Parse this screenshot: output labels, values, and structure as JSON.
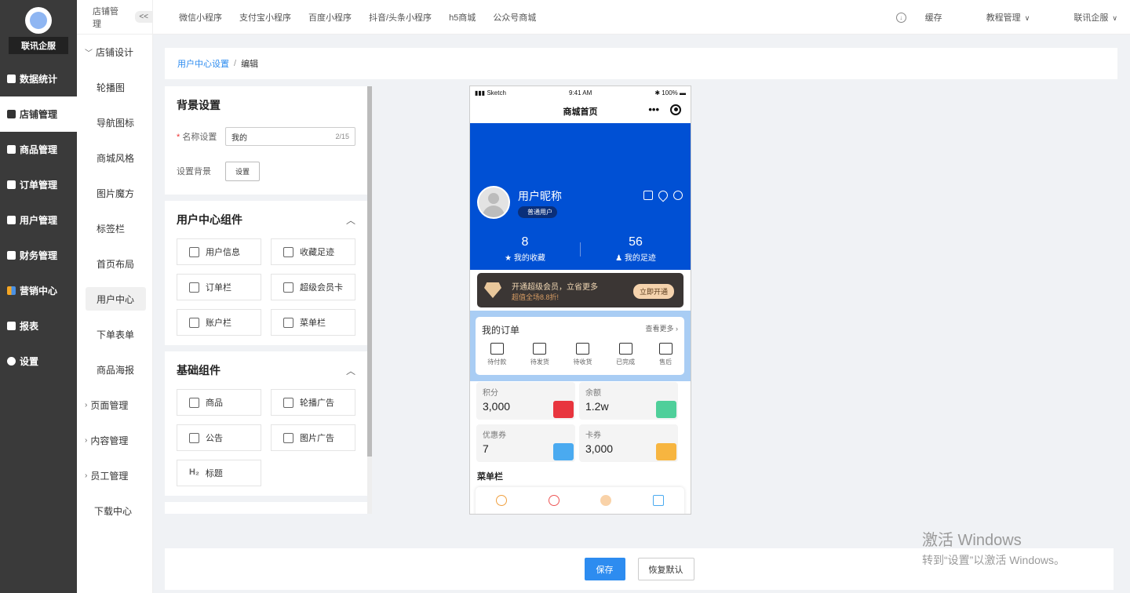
{
  "sidebar": {
    "brand": "联讯企服",
    "items": [
      {
        "label": "数据统计",
        "icon": "chart-icon"
      },
      {
        "label": "店铺管理",
        "icon": "shop-icon",
        "active": true
      },
      {
        "label": "商品管理",
        "icon": "goods-icon"
      },
      {
        "label": "订单管理",
        "icon": "order-icon"
      },
      {
        "label": "用户管理",
        "icon": "user-icon"
      },
      {
        "label": "财务管理",
        "icon": "finance-icon"
      },
      {
        "label": "营销中心",
        "icon": "marketing-icon"
      },
      {
        "label": "报表",
        "icon": "report-icon"
      },
      {
        "label": "设置",
        "icon": "settings-icon"
      }
    ]
  },
  "subsidebar": {
    "title": "店铺管理",
    "collapse": "<<",
    "group_open": "店铺设计",
    "items": [
      "轮播图",
      "导航图标",
      "商城风格",
      "图片魔方",
      "标签栏",
      "首页布局",
      "用户中心",
      "下单表单",
      "商品海报"
    ],
    "groups": [
      "页面管理",
      "内容管理",
      "员工管理"
    ],
    "download": "下载中心"
  },
  "topbar": {
    "tabs": [
      "微信小程序",
      "支付宝小程序",
      "百度小程序",
      "抖音/头条小程序",
      "h5商城",
      "公众号商城"
    ],
    "cache": "缓存",
    "tutorial": "教程管理",
    "company": "联讯企服"
  },
  "breadcrumb": {
    "link": "用户中心设置",
    "sep": "/",
    "current": "编辑"
  },
  "bg_settings": {
    "title": "背景设置",
    "name_label": "名称设置",
    "name_value": "我的",
    "name_count": "2/15",
    "bg_label": "设置背景",
    "bg_button": "设置"
  },
  "user_components": {
    "title": "用户中心组件",
    "items": [
      "用户信息",
      "收藏足迹",
      "订单栏",
      "超级会员卡",
      "账户栏",
      "菜单栏"
    ]
  },
  "basic_components": {
    "title": "基础组件",
    "items": [
      "商品",
      "轮播广告",
      "公告",
      "图片广告",
      "标题"
    ],
    "title_icon_text": "H₂"
  },
  "phone": {
    "carrier": "Sketch",
    "time": "9:41 AM",
    "battery": "100%",
    "nav_title": "商城首页",
    "user_name": "用户昵称",
    "user_level": "普通用户",
    "fav_count": "8",
    "fav_label": "我的收藏",
    "foot_count": "56",
    "foot_label": "我的足迹",
    "vip_title": "开通超级会员，立省更多",
    "vip_sub": "超值全场8.8折!",
    "vip_btn": "立即开通",
    "orders_title": "我的订单",
    "orders_more": "查看更多",
    "order_items": [
      "待付款",
      "待发货",
      "待收货",
      "已完成",
      "售后"
    ],
    "assets": [
      {
        "label": "积分",
        "value": "3,000",
        "color": "#e8353e"
      },
      {
        "label": "余额",
        "value": "1.2w",
        "color": "#4fcf9a"
      },
      {
        "label": "优惠券",
        "value": "7",
        "color": "#4aaaf0"
      },
      {
        "label": "卡券",
        "value": "3,000",
        "color": "#f7b540"
      }
    ],
    "menu_title": "菜单栏"
  },
  "footer": {
    "save": "保存",
    "reset": "恢复默认"
  },
  "watermark": {
    "line1": "激活 Windows",
    "line2": "转到“设置”以激活 Windows。"
  }
}
